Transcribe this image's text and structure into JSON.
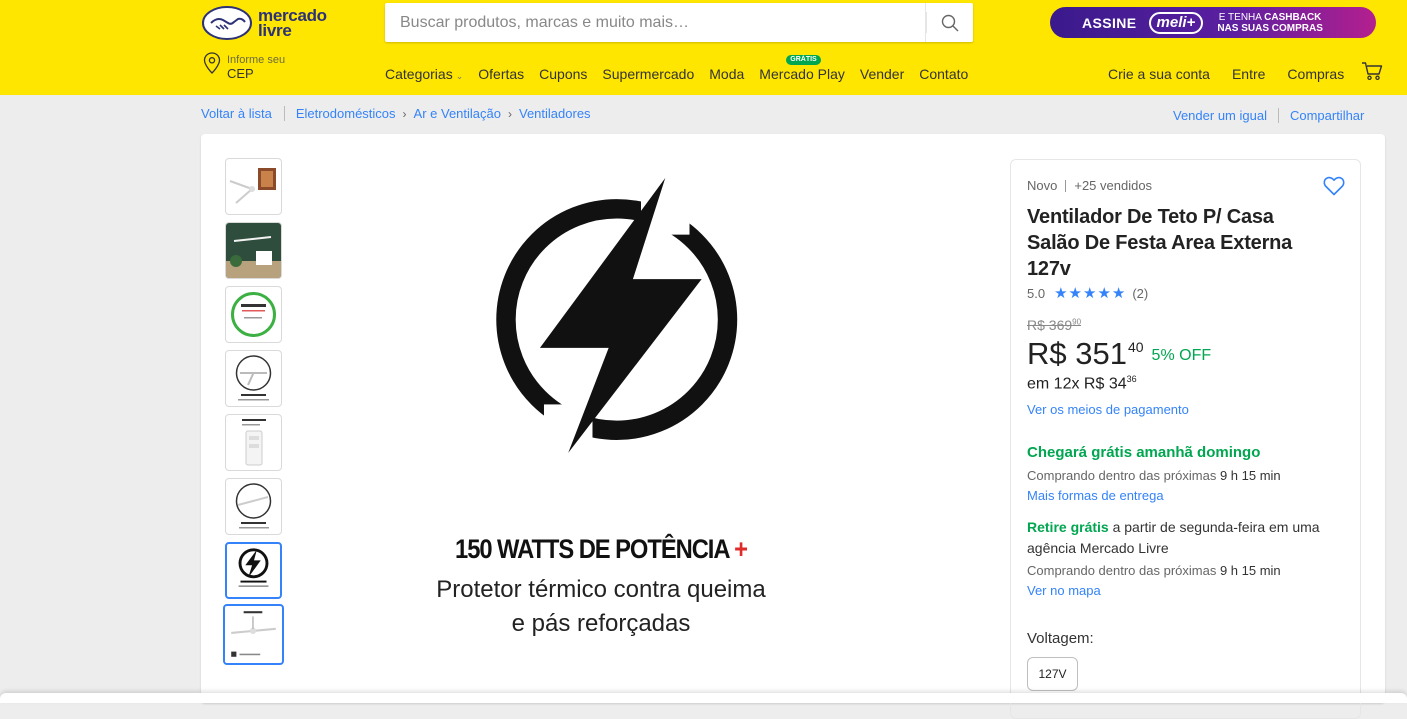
{
  "header": {
    "logo_line1": "mercado",
    "logo_line2": "livre",
    "search_placeholder": "Buscar produtos, marcas e muito mais…",
    "promo": {
      "assine": "ASSINE",
      "meli": "meli+",
      "line1": "E TENHA ",
      "line1_bold": "CASHBACK",
      "line2": "NAS SUAS COMPRAS"
    },
    "cep_small": "Informe seu",
    "cep_big": "CEP",
    "nav": {
      "categorias": "Categorias",
      "ofertas": "Ofertas",
      "cupons": "Cupons",
      "supermercado": "Supermercado",
      "moda": "Moda",
      "mercado_play": "Mercado Play",
      "gratis_badge": "GRÁTIS",
      "vender": "Vender",
      "contato": "Contato"
    },
    "user": {
      "crie": "Crie a sua conta",
      "entre": "Entre",
      "compras": "Compras"
    },
    "colors": {
      "brand_yellow": "#ffe600",
      "brand_blue": "#2d3277",
      "link_blue": "#3483fa",
      "green": "#00a650"
    }
  },
  "breadcrumb": {
    "back": "Voltar à lista",
    "items": [
      "Eletrodomésticos",
      "Ar e Ventilação",
      "Ventiladores"
    ]
  },
  "top_links": {
    "sell_same": "Vender um igual",
    "share": "Compartilhar"
  },
  "gallery": {
    "thumb_count": 8,
    "active_index": 6,
    "image_text": {
      "title": "150 WATTS DE POTÊNCIA",
      "plus": "+",
      "line1": "Protetor térmico contra queima",
      "line2": "e pás reforçadas"
    }
  },
  "product": {
    "condition": "Novo",
    "sold": "+25 vendidos",
    "title": "Ventilador De Teto P/ Casa Salão De Festa Area Externa 127v",
    "rating": "5.0",
    "reviews": "(2)",
    "old_price": "R$ 369",
    "old_cents": "90",
    "price": "R$ 351",
    "price_cents": "40",
    "discount": "5% OFF",
    "installments": "em 12x R$ 34",
    "installments_cents": "36",
    "payment_link": "Ver os meios de pagamento",
    "shipping_title": "Chegará grátis amanhã domingo",
    "shipping_sub_prefix": "Comprando dentro das próximas ",
    "shipping_sub_time": "9 h 15 min",
    "shipping_link": "Mais formas de entrega",
    "pickup_bold": "Retire grátis",
    "pickup_rest": " a partir de segunda-feira em uma agência Mercado Livre",
    "pickup_sub_prefix": "Comprando dentro das próximas ",
    "pickup_sub_time": "9 h 15 min",
    "map_link": "Ver no mapa",
    "voltage_label": "Voltagem:",
    "voltage_option": "127V"
  }
}
